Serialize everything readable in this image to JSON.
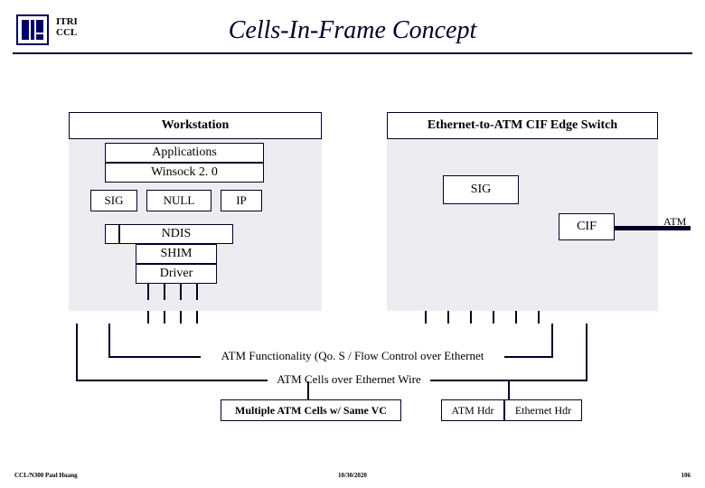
{
  "org": {
    "line1": "ITRI",
    "line2": "CCL"
  },
  "title": "Cells-In-Frame Concept",
  "left": {
    "heading": "Workstation",
    "apps": "Applications",
    "winsock": "Winsock 2. 0",
    "sig": "SIG",
    "null": "NULL",
    "ip": "IP",
    "ndis": "NDIS",
    "shim": "SHIM",
    "driver": "Driver"
  },
  "right": {
    "heading": "Ethernet-to-ATM CIF Edge Switch",
    "sig": "SIG",
    "cif": "CIF",
    "atm": "ATM"
  },
  "lower": {
    "atm_func": "ATM Functionality (Qo. S / Flow Control over Ethernet",
    "cells_over_wire": "ATM Cells over Ethernet Wire",
    "multi": "Multiple ATM Cells w/ Same VC",
    "atmhdr": "ATM Hdr",
    "ethhdr": "Ethernet Hdr"
  },
  "footer": {
    "left": "CCL/N300  Paul Huang",
    "center": "10/30/2020",
    "right": "106"
  }
}
